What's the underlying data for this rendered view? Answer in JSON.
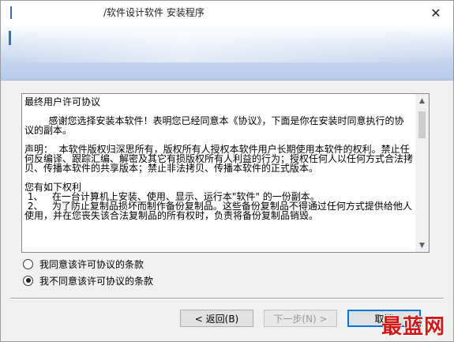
{
  "window": {
    "title": "/软件设计软件 安装程序",
    "close_glyph": "✕"
  },
  "license": {
    "paragraphs": [
      "最终用户许可协议",
      "        感谢您选择安装本软件！表明您已经同意本《协议》，下面是你在安装时同意执行的协议的副本。",
      "声明：  本软件版权归深思所有，版权所有人授权本软件用户长期使用本软件的权利。禁止任何反编译、跟踪汇编、解密及其它有损版权所有人利益的行为；授权任何人以任何方式合法拷贝、传播本软件的共享版本；禁止非法拷贝、传播本软件的正式版本。",
      "您有如下权利\n 1、   在一台计算机上安装、使用、显示、运行本\"软件\" 的一份副本。\n 2、   为了防止复制品损坏而制作备份复制品。这些备份复制品不得通过任何方式提供给他人使用，并在您丧失该合法复制品的所有权时，负责将备份复制品销毁。"
    ],
    "scroll_up_glyph": "▲",
    "scroll_down_glyph": "▼"
  },
  "options": {
    "agree_label": "我同意该许可协议的条款",
    "disagree_label": "我不同意该许可协议的条款",
    "selected": "disagree"
  },
  "buttons": {
    "back_label": "< 返回(B)",
    "next_label": "下一步(N) >",
    "cancel_label": "取消"
  },
  "watermark": {
    "text": "最蓝网"
  },
  "colors": {
    "accent": "#0078d7",
    "watermark": "#d01818"
  }
}
